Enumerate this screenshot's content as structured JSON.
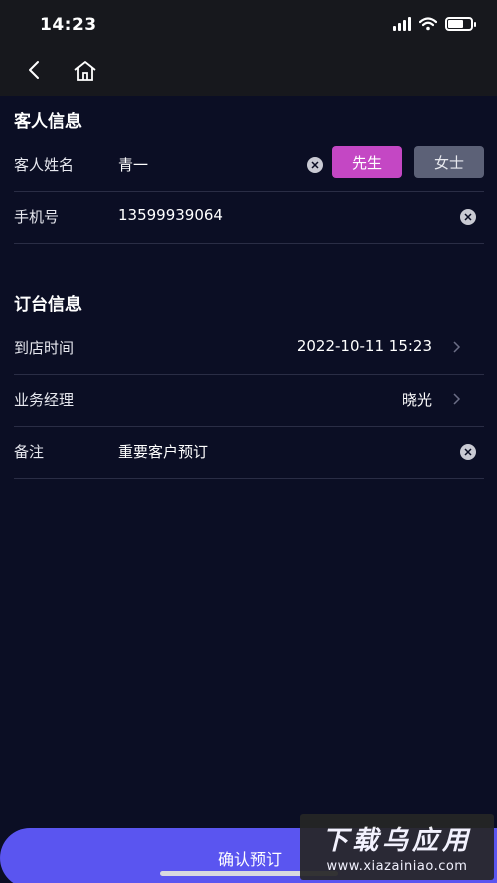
{
  "status_bar": {
    "time": "14:23"
  },
  "nav": {
    "back_icon": "chevron-left-icon",
    "home_icon": "home-icon"
  },
  "guest_section": {
    "title": "客人信息",
    "name_label": "客人姓名",
    "name_value": "青一",
    "male_label": "先生",
    "female_label": "女士",
    "phone_label": "手机号",
    "phone_value": "13599939064"
  },
  "booking_section": {
    "title": "订台信息",
    "arrival_label": "到店时间",
    "arrival_value": "2022-10-11 15:23",
    "manager_label": "业务经理",
    "manager_value": "晓光",
    "remark_label": "备注",
    "remark_value": "重要客户预订"
  },
  "footer": {
    "confirm_label": "确认预订"
  },
  "watermark": {
    "title": "下载乌应用",
    "url": "www.xiazainiao.com"
  },
  "colors": {
    "background": "#0b0e24",
    "header": "#17181d",
    "male_button": "#c447c4",
    "female_button": "#5c6177",
    "confirm_button": "#5a55f0"
  }
}
